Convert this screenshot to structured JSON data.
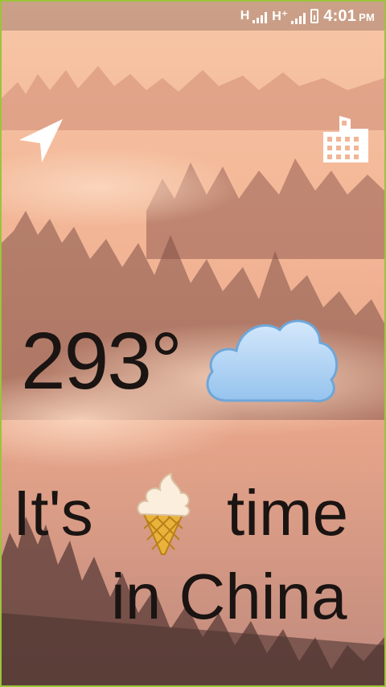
{
  "status_bar": {
    "net1": "H",
    "net2": "H⁺",
    "time": "4:01",
    "ampm": "PM"
  },
  "icons": {
    "location": "navigation-arrow-icon",
    "city": "city-buildings-icon",
    "weather": "cloud-icon",
    "food": "ice-cream-icon"
  },
  "weather": {
    "temperature": "293°"
  },
  "message": {
    "part1": "It's",
    "part2": "time",
    "part3": "in China"
  }
}
